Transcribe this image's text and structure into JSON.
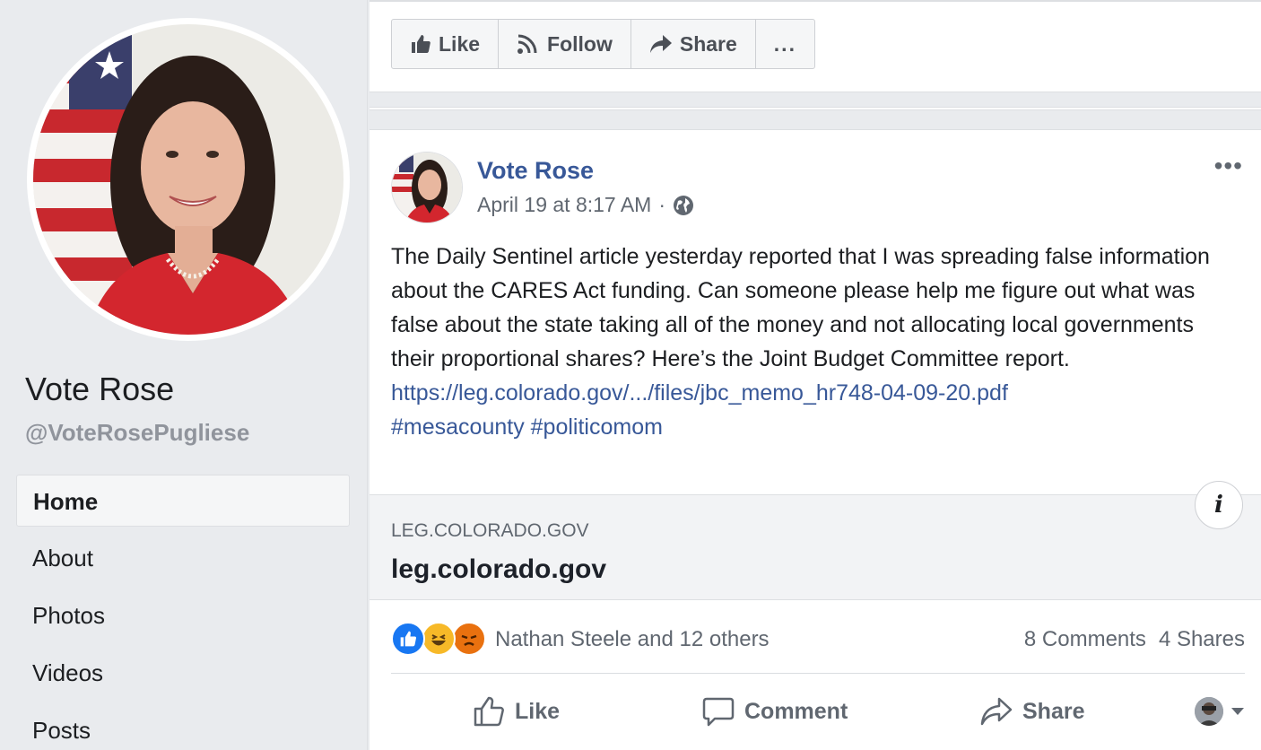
{
  "sidebar": {
    "page_name": "Vote Rose",
    "handle": "@VoteRosePugliese",
    "nav": [
      {
        "label": "Home"
      },
      {
        "label": "About"
      },
      {
        "label": "Photos"
      },
      {
        "label": "Videos"
      },
      {
        "label": "Posts"
      }
    ]
  },
  "action_bar": {
    "like": "Like",
    "follow": "Follow",
    "share": "Share",
    "more": "..."
  },
  "post": {
    "author": "Vote Rose",
    "timestamp": "April 19 at 8:17 AM",
    "separator": "·",
    "text": "The Daily Sentinel article yesterday reported that I was spreading false information about the CARES Act funding. Can someone please help me figure out what was false about the state taking all of the money and not allocating local governments their proportional shares? Here’s the Joint Budget Committee report.",
    "link": "https://leg.colorado.gov/.../files/jbc_memo_hr748-04-09-20.pdf",
    "hashtag1": "#mesacounty",
    "hashtag2": "#politicomom",
    "menu": "•••",
    "preview": {
      "domain": "LEG.COLORADO.GOV",
      "title": "leg.colorado.gov",
      "info_icon": "i"
    },
    "reactions": {
      "reactors": "Nathan Steele and 12 others",
      "comments": "8 Comments",
      "shares": "4 Shares"
    },
    "actions": {
      "like": "Like",
      "comment": "Comment",
      "share": "Share"
    }
  },
  "colors": {
    "link": "#385898",
    "background": "#e9ebee",
    "like_blue": "#1877f2",
    "haha_yellow": "#f7b928",
    "angry_orange": "#e9710f"
  }
}
